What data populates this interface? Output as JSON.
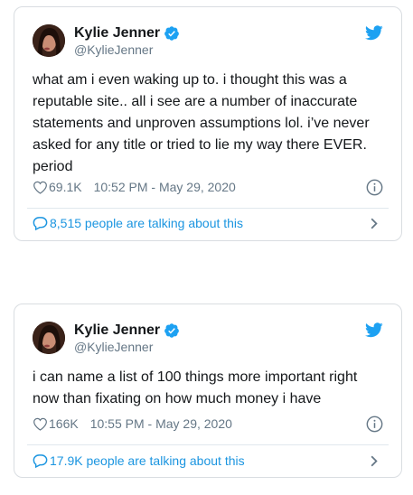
{
  "colors": {
    "link_blue": "#1b95e0",
    "verified_blue": "#1da1f2",
    "secondary_text": "#657786",
    "border": "#d9dde1"
  },
  "icons": {
    "verified": "verified-badge-icon",
    "brand": "twitter-bird-icon",
    "like": "heart-icon",
    "info": "info-icon",
    "conversation": "speech-bubble-icon",
    "expand": "chevron-right-icon"
  },
  "tweets": [
    {
      "author": {
        "display_name": "Kylie Jenner",
        "handle": "@KylieJenner"
      },
      "text": "what am i even waking up to. i thought this was a\nreputable site.. all i see are a number of inaccurate\nstatements and unproven assumptions lol. i’ve never\nasked for any title or tried to lie my way there EVER.\nperiod",
      "likes": "69.1K",
      "timestamp": "10:52 PM - May 29, 2020",
      "conversation": "8,515 people are talking about this"
    },
    {
      "author": {
        "display_name": "Kylie Jenner",
        "handle": "@KylieJenner"
      },
      "text": "i can name a list of 100 things more important right\nnow than fixating on how much money i have",
      "likes": "166K",
      "timestamp": "10:55 PM - May 29, 2020",
      "conversation": "17.9K people are talking about this"
    }
  ]
}
